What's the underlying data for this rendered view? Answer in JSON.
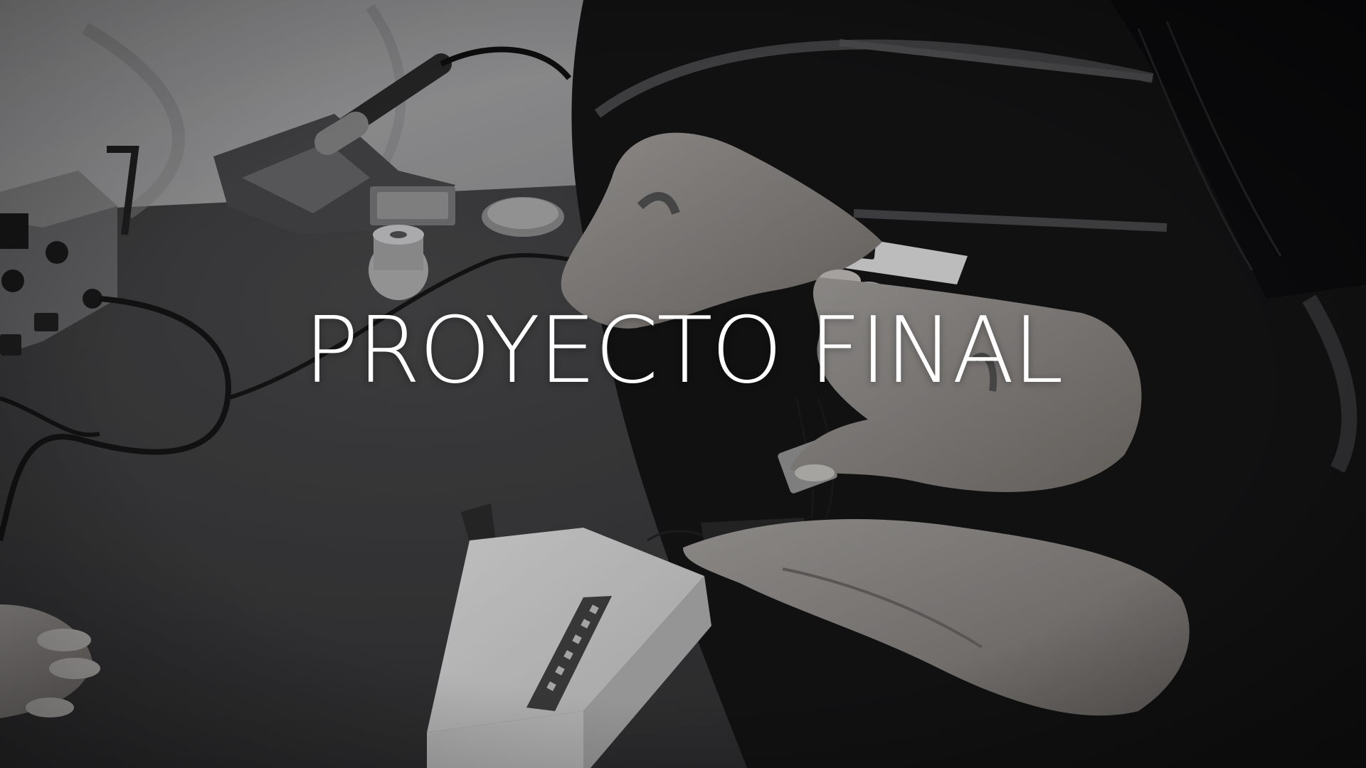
{
  "slide": {
    "title": "PROYECTO FINAL"
  },
  "photo": {
    "style": "grayscale",
    "subject": "hands-assembling-electronics"
  }
}
